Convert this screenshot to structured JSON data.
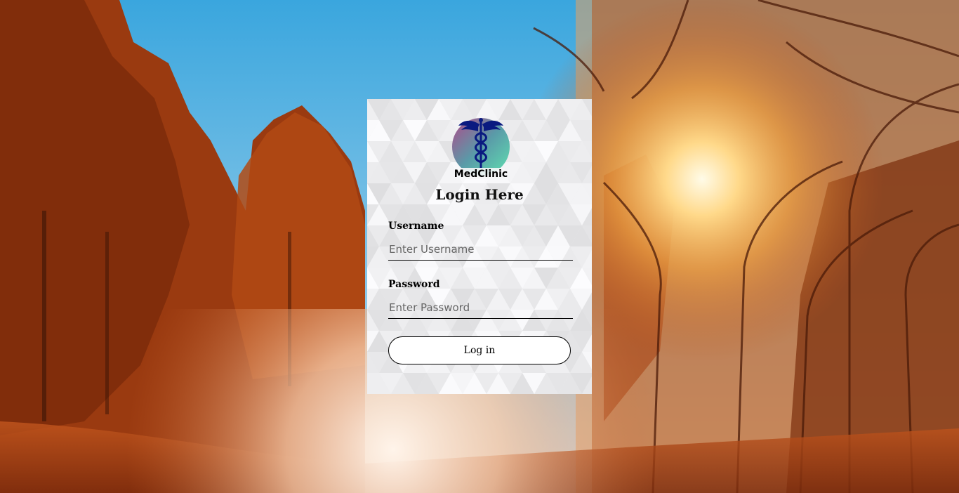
{
  "logo": {
    "text": "MedClinic",
    "icon": "caduceus-icon"
  },
  "login": {
    "title": "Login Here",
    "username_label": "Username",
    "username_placeholder": "Enter Username",
    "password_label": "Password",
    "password_placeholder": "Enter Password",
    "button_label": "Log in"
  },
  "colors": {
    "logo_gradient_start": "#b04a8a",
    "logo_gradient_end": "#5fe0b0",
    "caduceus": "#0a1a80"
  }
}
